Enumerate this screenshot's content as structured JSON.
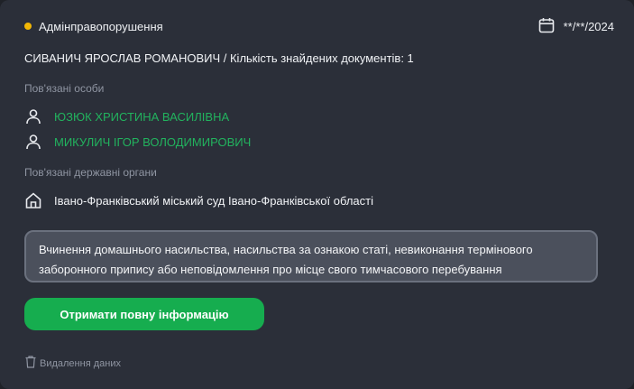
{
  "header": {
    "category": "Адмінправопорушення",
    "date": "**/**/2024",
    "status_color": "#f2b705",
    "date_icon": "calendar-icon"
  },
  "title": "СИВАНИЧ ЯРОСЛАВ РОМАНОВИЧ / Кількість знайдених документів: 1",
  "related_persons": {
    "label": "Пов'язані особи",
    "icon": "person-icon",
    "items": [
      {
        "name": "ЮЗЮК ХРИСТИНА ВАСИЛІВНА"
      },
      {
        "name": "МИКУЛИЧ ІГОР ВОЛОДИМИРОВИЧ"
      }
    ]
  },
  "related_authorities": {
    "label": "Пов'язані державні органи",
    "icon": "building-icon",
    "items": [
      {
        "name": "Івано-Франківський міський суд Івано-Франківської області"
      }
    ]
  },
  "description": "Вчинення домашнього насильства, насильства за ознакою статі, невиконання термінового заборонного припису або неповідомлення про місце свого тимчасового перебування",
  "actions": {
    "full_info_label": "Отримати повну інформацію",
    "delete_label": "Видалення даних",
    "delete_icon": "trash-icon"
  },
  "colors": {
    "accent_green": "#16ad4f",
    "link_green": "#22b35e",
    "card_bg": "#2b2f39"
  }
}
